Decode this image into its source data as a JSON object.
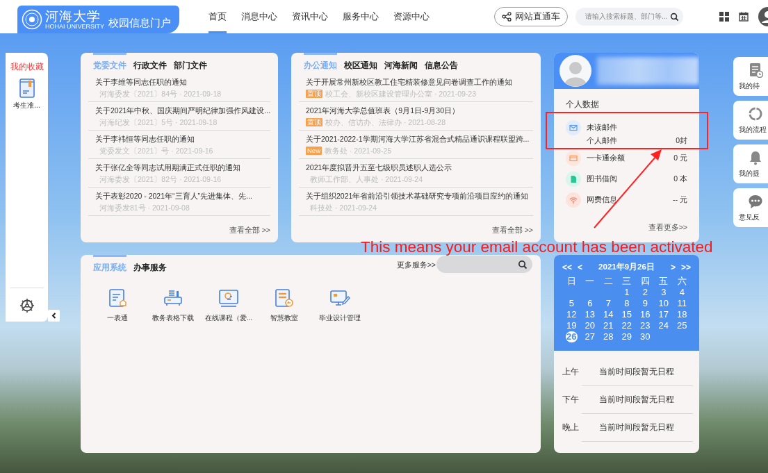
{
  "header": {
    "logo_text": "河海大学",
    "logo_subtitle": "HOHAI UNIVERSITY",
    "portal_title": "校园信息门户",
    "nav": [
      {
        "label": "首页",
        "selected": true
      },
      {
        "label": "消息中心",
        "selected": false
      },
      {
        "label": "资讯中心",
        "selected": false
      },
      {
        "label": "服务中心",
        "selected": false
      },
      {
        "label": "资源中心",
        "selected": false
      }
    ],
    "site_link": "网站直通车",
    "search": {
      "placeholder": "请输入搜索标题、部门等..."
    }
  },
  "favorites": {
    "title": "我的收藏",
    "items": [
      {
        "label": "考生准..."
      }
    ]
  },
  "documents": {
    "tabs": [
      {
        "label": "党委文件",
        "selected": true
      },
      {
        "label": "行政文件",
        "selected": false
      },
      {
        "label": "部门文件",
        "selected": false
      }
    ],
    "items": [
      {
        "title": "关于李维等同志任职的通知",
        "meta": "河海委发〔2021〕84号 · 2021-09-18"
      },
      {
        "title": "关于2021年中秋、国庆期间严明纪律加强作风建设...",
        "meta": "河海纪发〔2021〕5号 · 2021-09-18"
      },
      {
        "title": "关于李袆恒等同志任职的通知",
        "meta": "党委发文〔2021〕号 · 2021-09-16"
      },
      {
        "title": "关于张亿全等同志试用期满正式任职的通知",
        "meta": "河海委发〔2021〕82号 · 2021-09-16"
      },
      {
        "title": "关于表彰2020 - 2021年“三育人”先进集体、先...",
        "meta": "河海委发81号 · 2021-09-08"
      }
    ],
    "more": "查看全部 >>"
  },
  "notices": {
    "tabs": [
      {
        "label": "办公通知",
        "selected": true
      },
      {
        "label": "校区通知",
        "selected": false
      },
      {
        "label": "河海新闻",
        "selected": false
      },
      {
        "label": "信息公告",
        "selected": false
      }
    ],
    "items": [
      {
        "title": "关于开展常州新校区教工住宅精装修意见问卷调查工作的通知",
        "tag": "置顶",
        "meta": "校工会、新校区建设管理办公室 · 2021-09-23"
      },
      {
        "title": "2021年河海大学总值班表（9月1日-9月30日）",
        "tag": "置顶",
        "meta": "校办、信访办、法律办 · 2021-08-28"
      },
      {
        "title": "关于2021-2022-1学期河海大学江苏省混合式精品通识课程联盟跨...",
        "tag": "New",
        "meta": "教务处 · 2021-09-25"
      },
      {
        "title": "2021年度拟晋升五至七级职员述职人选公示",
        "meta": "教师工作部、人事处 · 2021-09-24"
      },
      {
        "title": "关于组织2021年省前沿引领技术基础研究专项前沿项目应约的通知",
        "meta": "科技处 · 2021-09-24"
      }
    ],
    "more": "查看全部 >>"
  },
  "profile": {
    "section_title": "个人数据",
    "stats": [
      {
        "kind": "mail",
        "label": "未读邮件",
        "sub_label": "个人邮件",
        "value": "0封"
      },
      {
        "kind": "card",
        "label": "一卡通余额",
        "value": "0 元"
      },
      {
        "kind": "book",
        "label": "图书借阅",
        "value": "0 本"
      },
      {
        "kind": "wifi",
        "label": "网费信息",
        "value": "-- 元"
      }
    ],
    "more": "查看更多>>"
  },
  "apps": {
    "tabs": [
      {
        "label": "应用系统",
        "selected": true
      },
      {
        "label": "办事服务",
        "selected": false
      }
    ],
    "more": "更多服务>>",
    "items": [
      {
        "kind": "form",
        "label": "一表通"
      },
      {
        "kind": "printer",
        "label": "教务表格下载"
      },
      {
        "kind": "course",
        "label": "在线课程（爱..."
      },
      {
        "kind": "classroom",
        "label": "智慧教室"
      },
      {
        "kind": "design",
        "label": "毕业设计管理"
      }
    ]
  },
  "calendar": {
    "prev_year": "<<",
    "prev_month": "<",
    "title": "2021年9月26日",
    "next_month": ">",
    "next_year": ">>",
    "weekdays": [
      "日",
      "一",
      "二",
      "三",
      "四",
      "五",
      "六"
    ],
    "weeks": [
      [
        {
          "day": "1",
          "selected": false
        },
        {
          "day": "2",
          "selected": false
        },
        {
          "day": "3",
          "selected": false
        },
        {
          "day": "4",
          "selected": false
        }
      ],
      [
        {
          "day": "5",
          "selected": false
        },
        {
          "day": "6",
          "selected": false
        },
        {
          "day": "7",
          "selected": false
        },
        {
          "day": "8",
          "selected": false
        },
        {
          "day": "9",
          "selected": false
        },
        {
          "day": "10",
          "selected": false
        },
        {
          "day": "11",
          "selected": false
        }
      ],
      [
        {
          "day": "12",
          "selected": false
        },
        {
          "day": "13",
          "selected": false
        },
        {
          "day": "14",
          "selected": false
        },
        {
          "day": "15",
          "selected": false
        },
        {
          "day": "16",
          "selected": false
        },
        {
          "day": "17",
          "selected": false
        },
        {
          "day": "18",
          "selected": false
        }
      ],
      [
        {
          "day": "19",
          "selected": false
        },
        {
          "day": "20",
          "selected": false
        },
        {
          "day": "21",
          "selected": false
        },
        {
          "day": "22",
          "selected": false
        },
        {
          "day": "23",
          "selected": false
        },
        {
          "day": "24",
          "selected": false
        },
        {
          "day": "25",
          "selected": false
        }
      ],
      [
        {
          "day": "26",
          "selected": true
        },
        {
          "day": "27",
          "selected": false
        },
        {
          "day": "28",
          "selected": false
        },
        {
          "day": "29",
          "selected": false
        },
        {
          "day": "30",
          "selected": false
        }
      ]
    ]
  },
  "schedule": [
    {
      "period": "上午",
      "text": "当前时间段暂无日程"
    },
    {
      "period": "下午",
      "text": "当前时间段暂无日程"
    },
    {
      "period": "晚上",
      "text": "当前时间段暂无日程"
    }
  ],
  "quick_links": [
    {
      "kind": "todo",
      "label": "我的待"
    },
    {
      "kind": "process",
      "label": "我的流程"
    },
    {
      "kind": "bell",
      "label": "我的提"
    },
    {
      "kind": "chat",
      "label": "意见反"
    }
  ],
  "annotation": {
    "text": "This means your email account has been activated"
  }
}
